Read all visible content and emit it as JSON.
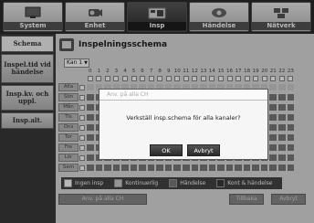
{
  "nav": {
    "items": [
      {
        "label": "System",
        "icon": "monitor-icon",
        "active": false
      },
      {
        "label": "Enhet",
        "icon": "camera-icon",
        "active": false
      },
      {
        "label": "Insp",
        "icon": "recorder-icon",
        "active": true
      },
      {
        "label": "Händelse",
        "icon": "event-icon",
        "active": false
      },
      {
        "label": "Nätverk",
        "icon": "network-icon",
        "active": false
      }
    ]
  },
  "sidebar": {
    "items": [
      {
        "label": "Schema",
        "active": true
      },
      {
        "label": "Inspel.tid vid händelse",
        "active": false
      },
      {
        "label": "Insp.kv. och uppl.",
        "active": false
      },
      {
        "label": "Insp.alt.",
        "active": false
      }
    ]
  },
  "page": {
    "title": "Inspelningsschema",
    "channel": "Kan 1"
  },
  "schedule": {
    "alla_label": "Alla",
    "hours": [
      "0",
      "1",
      "2",
      "3",
      "4",
      "5",
      "6",
      "7",
      "8",
      "9",
      "10",
      "11",
      "12",
      "13",
      "14",
      "15",
      "16",
      "17",
      "18",
      "19",
      "20",
      "21",
      "22",
      "23"
    ],
    "days": [
      "Sön",
      "Mån",
      "Tis",
      "Ons",
      "Tor",
      "Fre",
      "Lör",
      "Sem"
    ]
  },
  "legend": [
    {
      "label": "Ingen insp",
      "color": "#ffffff"
    },
    {
      "label": "Kontinuerlig",
      "color": "#cfcfcf"
    },
    {
      "label": "Händelse",
      "color": "#7a7a7a"
    },
    {
      "label": "Kont & händelse",
      "color": "#3a3a3a"
    }
  ],
  "buttons": {
    "apply_all": "Anv. på alla CH",
    "back": "Tillbaka",
    "cancel": "Avbryt"
  },
  "dialog": {
    "title": "Anv. på alla CH",
    "message": "Verkställ insp.schema för alla kanaler?",
    "ok": "OK",
    "cancel": "Avbryt"
  }
}
